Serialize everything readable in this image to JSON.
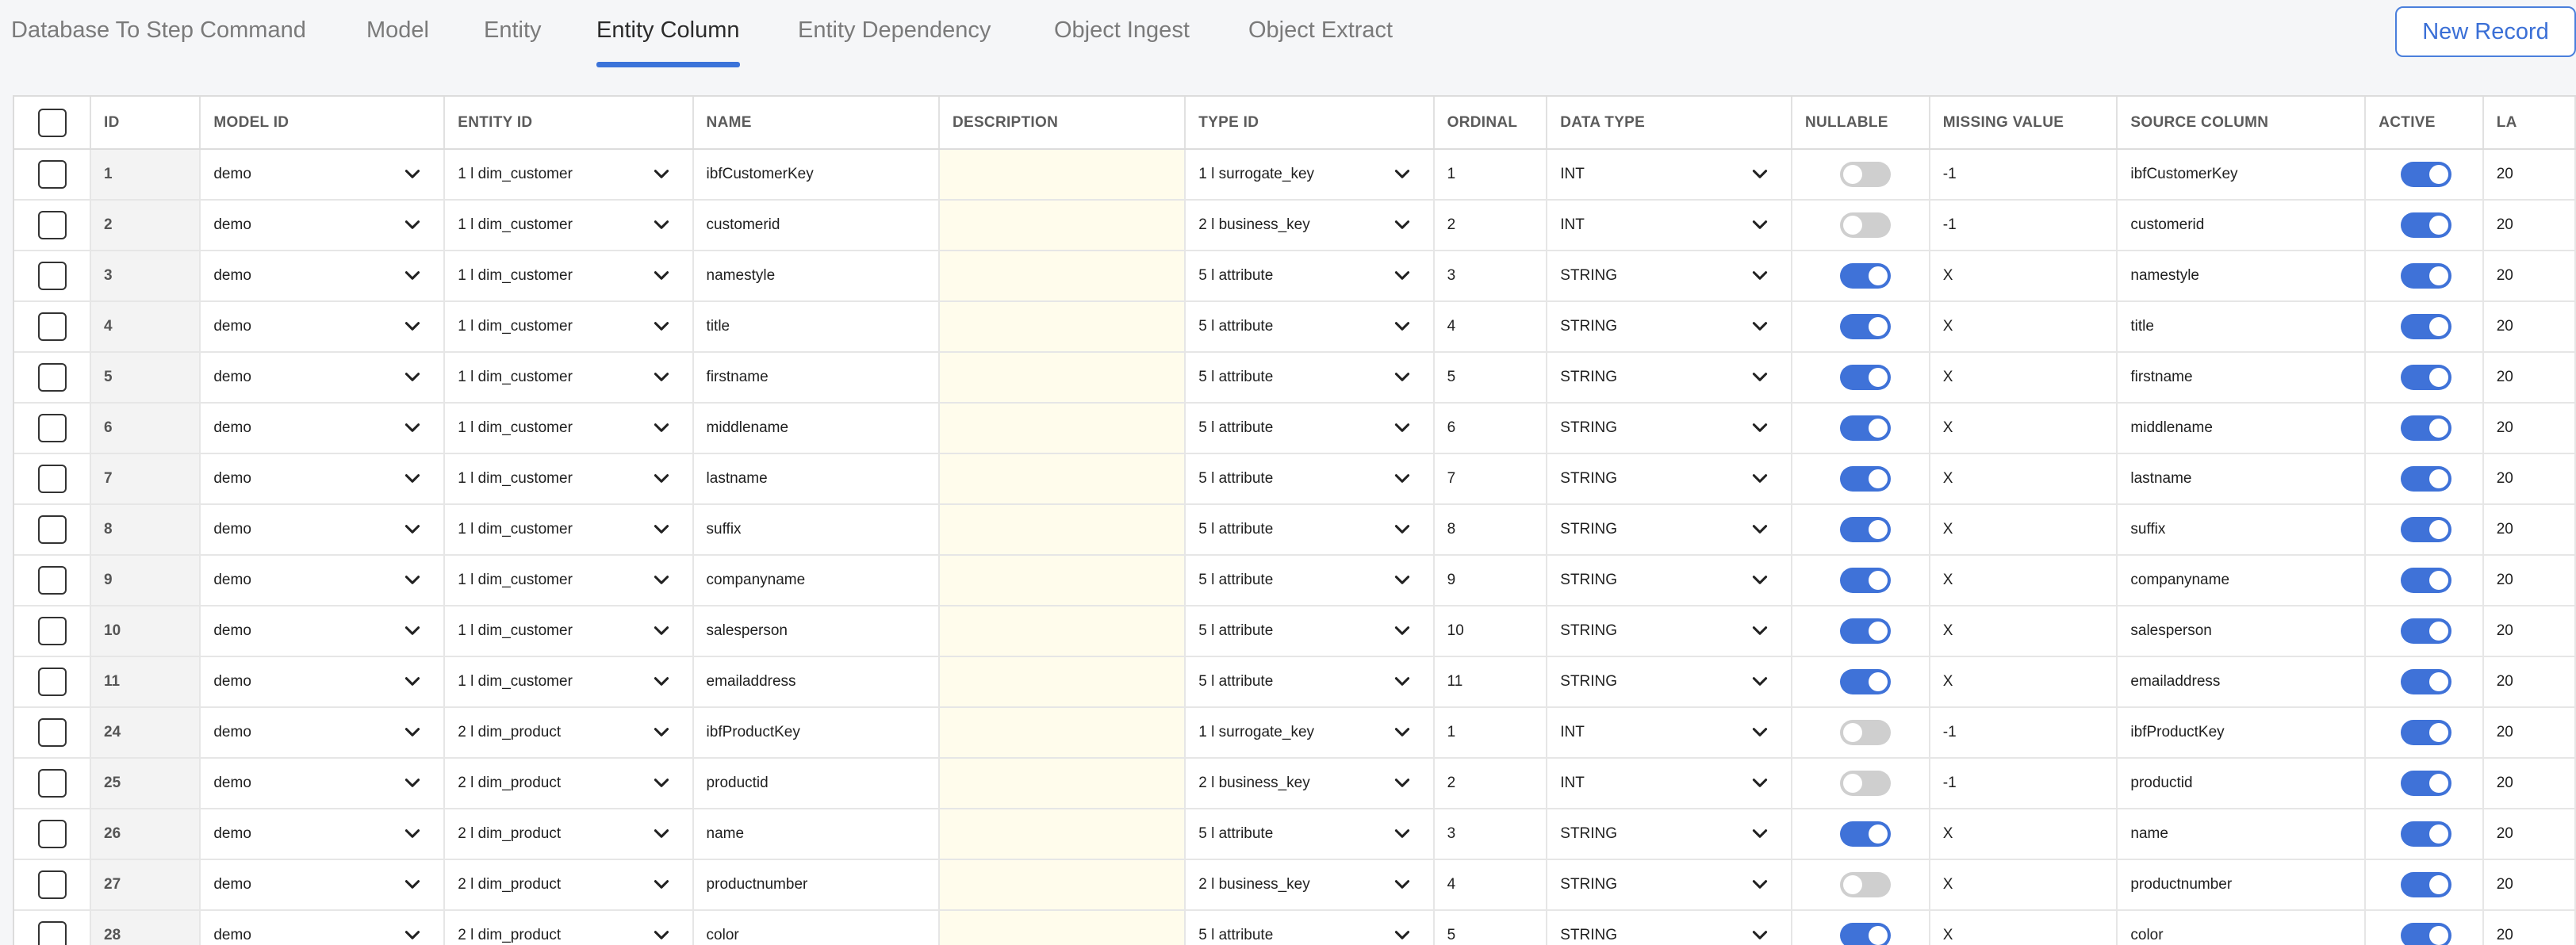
{
  "tabs": [
    {
      "label": "Database To Step Command",
      "active": false
    },
    {
      "label": "Model",
      "active": false
    },
    {
      "label": "Entity",
      "active": false
    },
    {
      "label": "Entity Column",
      "active": true
    },
    {
      "label": "Entity Dependency",
      "active": false
    },
    {
      "label": "Object Ingest",
      "active": false
    },
    {
      "label": "Object Extract",
      "active": false
    }
  ],
  "new_record_label": "New Record",
  "columns": [
    "ID",
    "MODEL ID",
    "ENTITY ID",
    "NAME",
    "DESCRIPTION",
    "TYPE ID",
    "ORDINAL",
    "DATA TYPE",
    "NULLABLE",
    "MISSING VALUE",
    "SOURCE COLUMN",
    "ACTIVE",
    "LA"
  ],
  "rows": [
    {
      "id": "1",
      "model": "demo",
      "entity": "1 l dim_customer",
      "name": "ibfCustomerKey",
      "description": "",
      "type": "1 l surrogate_key",
      "ordinal": "1",
      "data_type": "INT",
      "nullable": false,
      "missing": "-1",
      "source": "ibfCustomerKey",
      "active": true,
      "last": "20"
    },
    {
      "id": "2",
      "model": "demo",
      "entity": "1 l dim_customer",
      "name": "customerid",
      "description": "",
      "type": "2 l business_key",
      "ordinal": "2",
      "data_type": "INT",
      "nullable": false,
      "missing": "-1",
      "source": "customerid",
      "active": true,
      "last": "20"
    },
    {
      "id": "3",
      "model": "demo",
      "entity": "1 l dim_customer",
      "name": "namestyle",
      "description": "",
      "type": "5 l attribute",
      "ordinal": "3",
      "data_type": "STRING",
      "nullable": true,
      "missing": "X",
      "source": "namestyle",
      "active": true,
      "last": "20"
    },
    {
      "id": "4",
      "model": "demo",
      "entity": "1 l dim_customer",
      "name": "title",
      "description": "",
      "type": "5 l attribute",
      "ordinal": "4",
      "data_type": "STRING",
      "nullable": true,
      "missing": "X",
      "source": "title",
      "active": true,
      "last": "20"
    },
    {
      "id": "5",
      "model": "demo",
      "entity": "1 l dim_customer",
      "name": "firstname",
      "description": "",
      "type": "5 l attribute",
      "ordinal": "5",
      "data_type": "STRING",
      "nullable": true,
      "missing": "X",
      "source": "firstname",
      "active": true,
      "last": "20"
    },
    {
      "id": "6",
      "model": "demo",
      "entity": "1 l dim_customer",
      "name": "middlename",
      "description": "",
      "type": "5 l attribute",
      "ordinal": "6",
      "data_type": "STRING",
      "nullable": true,
      "missing": "X",
      "source": "middlename",
      "active": true,
      "last": "20"
    },
    {
      "id": "7",
      "model": "demo",
      "entity": "1 l dim_customer",
      "name": "lastname",
      "description": "",
      "type": "5 l attribute",
      "ordinal": "7",
      "data_type": "STRING",
      "nullable": true,
      "missing": "X",
      "source": "lastname",
      "active": true,
      "last": "20"
    },
    {
      "id": "8",
      "model": "demo",
      "entity": "1 l dim_customer",
      "name": "suffix",
      "description": "",
      "type": "5 l attribute",
      "ordinal": "8",
      "data_type": "STRING",
      "nullable": true,
      "missing": "X",
      "source": "suffix",
      "active": true,
      "last": "20"
    },
    {
      "id": "9",
      "model": "demo",
      "entity": "1 l dim_customer",
      "name": "companyname",
      "description": "",
      "type": "5 l attribute",
      "ordinal": "9",
      "data_type": "STRING",
      "nullable": true,
      "missing": "X",
      "source": "companyname",
      "active": true,
      "last": "20"
    },
    {
      "id": "10",
      "model": "demo",
      "entity": "1 l dim_customer",
      "name": "salesperson",
      "description": "",
      "type": "5 l attribute",
      "ordinal": "10",
      "data_type": "STRING",
      "nullable": true,
      "missing": "X",
      "source": "salesperson",
      "active": true,
      "last": "20"
    },
    {
      "id": "11",
      "model": "demo",
      "entity": "1 l dim_customer",
      "name": "emailaddress",
      "description": "",
      "type": "5 l attribute",
      "ordinal": "11",
      "data_type": "STRING",
      "nullable": true,
      "missing": "X",
      "source": "emailaddress",
      "active": true,
      "last": "20"
    },
    {
      "id": "24",
      "model": "demo",
      "entity": "2 l dim_product",
      "name": "ibfProductKey",
      "description": "",
      "type": "1 l surrogate_key",
      "ordinal": "1",
      "data_type": "INT",
      "nullable": false,
      "missing": "-1",
      "source": "ibfProductKey",
      "active": true,
      "last": "20"
    },
    {
      "id": "25",
      "model": "demo",
      "entity": "2 l dim_product",
      "name": "productid",
      "description": "",
      "type": "2 l business_key",
      "ordinal": "2",
      "data_type": "INT",
      "nullable": false,
      "missing": "-1",
      "source": "productid",
      "active": true,
      "last": "20"
    },
    {
      "id": "26",
      "model": "demo",
      "entity": "2 l dim_product",
      "name": "name",
      "description": "",
      "type": "5 l attribute",
      "ordinal": "3",
      "data_type": "STRING",
      "nullable": true,
      "missing": "X",
      "source": "name",
      "active": true,
      "last": "20"
    },
    {
      "id": "27",
      "model": "demo",
      "entity": "2 l dim_product",
      "name": "productnumber",
      "description": "",
      "type": "2 l business_key",
      "ordinal": "4",
      "data_type": "STRING",
      "nullable": false,
      "missing": "X",
      "source": "productnumber",
      "active": true,
      "last": "20"
    },
    {
      "id": "28",
      "model": "demo",
      "entity": "2 l dim_product",
      "name": "color",
      "description": "",
      "type": "5 l attribute",
      "ordinal": "5",
      "data_type": "STRING",
      "nullable": true,
      "missing": "X",
      "source": "color",
      "active": true,
      "last": "20"
    }
  ]
}
